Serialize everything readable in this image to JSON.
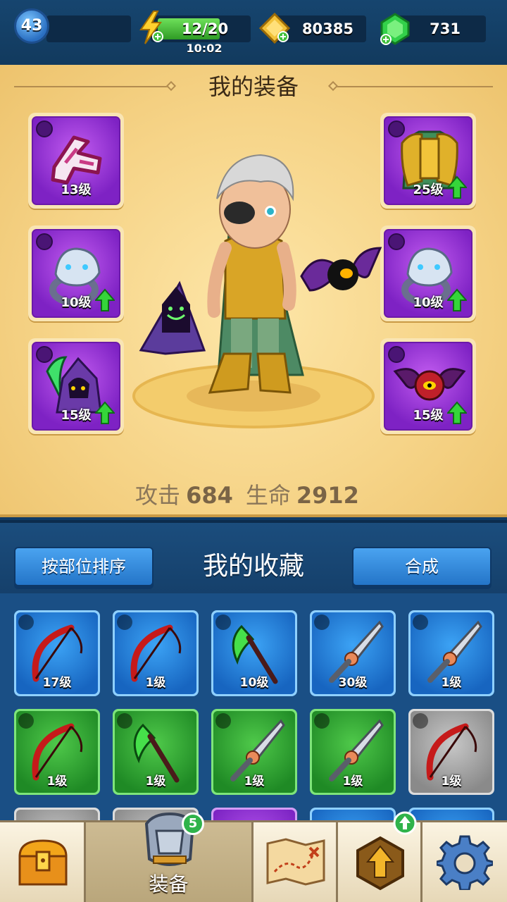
{
  "topbar": {
    "level": "43",
    "energy": "12/20",
    "energy_timer": "10:02",
    "gold": "80385",
    "gems": "731",
    "icons": {
      "level": "level-badge-icon",
      "energy": "lightning-bolt-icon",
      "gold": "gold-ticket-icon",
      "gems": "green-gem-icon"
    }
  },
  "equipment": {
    "title": "我的装备",
    "slots": [
      {
        "level": "13级",
        "type_icon": "bow-slot-icon",
        "item_icon": "pink-boomerang-icon",
        "upgrade": false
      },
      {
        "level": "10级",
        "type_icon": "ring-slot-icon",
        "item_icon": "wolf-ring-icon",
        "upgrade": true
      },
      {
        "level": "15级",
        "type_icon": "pet-slot-icon",
        "item_icon": "reaper-pet-icon",
        "upgrade": true
      },
      {
        "level": "25级",
        "type_icon": "armor-slot-icon",
        "item_icon": "gold-armor-icon",
        "upgrade": true
      },
      {
        "level": "10级",
        "type_icon": "ring-slot-icon",
        "item_icon": "wolf-ring-icon",
        "upgrade": true
      },
      {
        "level": "15级",
        "type_icon": "pet-slot-icon",
        "item_icon": "bat-pet-icon",
        "upgrade": true
      }
    ],
    "stats": {
      "attack_label": "攻击",
      "attack": "684",
      "hp_label": "生命",
      "hp": "2912"
    }
  },
  "collection": {
    "sort_button": "按部位排序",
    "title": "我的收藏",
    "merge_button": "合成",
    "items": [
      {
        "level": "17级",
        "rarity": "blue",
        "icon": "red-bow-icon"
      },
      {
        "level": "1级",
        "rarity": "blue",
        "icon": "red-bow-icon"
      },
      {
        "level": "10级",
        "rarity": "blue",
        "icon": "green-scythe-icon"
      },
      {
        "level": "30级",
        "rarity": "blue",
        "icon": "sword-icon"
      },
      {
        "level": "1级",
        "rarity": "blue",
        "icon": "sword-icon"
      },
      {
        "level": "1级",
        "rarity": "green",
        "icon": "red-bow-icon"
      },
      {
        "level": "1级",
        "rarity": "green",
        "icon": "green-scythe-icon"
      },
      {
        "level": "1级",
        "rarity": "green",
        "icon": "sword-icon"
      },
      {
        "level": "1级",
        "rarity": "green",
        "icon": "sword-icon"
      },
      {
        "level": "1级",
        "rarity": "grey",
        "icon": "red-bow-icon"
      }
    ]
  },
  "nav": {
    "equip_label": "装备",
    "equip_badge": "5",
    "icons": [
      "treasure-chest-icon",
      "armor-icon",
      "map-icon",
      "upgrade-arrow-icon",
      "settings-gear-icon"
    ]
  },
  "colors": {
    "rarity_purple": "#7e22c4",
    "rarity_blue": "#1765c0",
    "rarity_green": "#1f8a25",
    "rarity_grey": "#8a8a8a"
  }
}
